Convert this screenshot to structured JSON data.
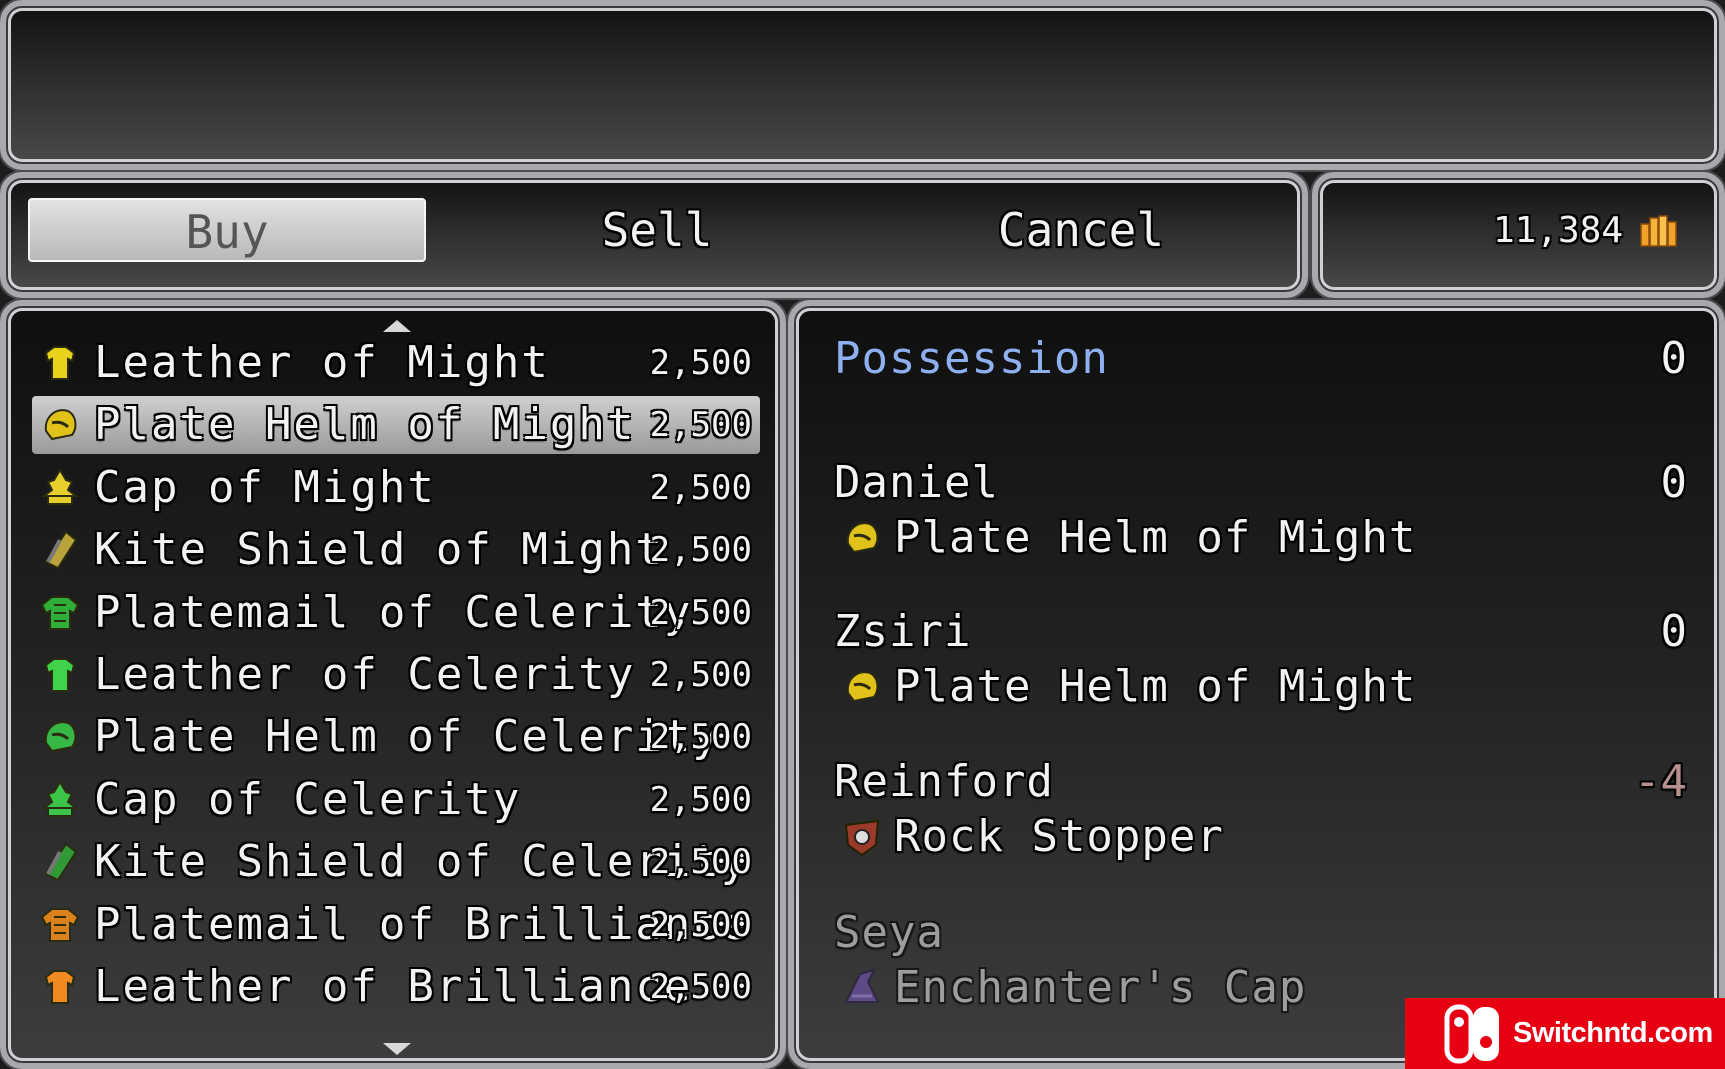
{
  "commands": [
    {
      "label": "Buy",
      "selected": true
    },
    {
      "label": "Sell",
      "selected": false
    },
    {
      "label": "Cancel",
      "selected": false
    }
  ],
  "gold": {
    "value": "11,384",
    "icon": "gold-coins-icon"
  },
  "items": [
    {
      "name": "Leather of Might",
      "price": "2,500",
      "icon": "leather-armor-icon",
      "color": "#e8d21c",
      "selected": false
    },
    {
      "name": "Plate Helm of Might",
      "price": "2,500",
      "icon": "plate-helm-icon",
      "color": "#e0c21a",
      "selected": true
    },
    {
      "name": "Cap of Might",
      "price": "2,500",
      "icon": "cap-icon",
      "color": "#e6cf2a",
      "selected": false
    },
    {
      "name": "Kite Shield of Might",
      "price": "2,500",
      "icon": "kite-shield-icon",
      "color": "#b8a43a",
      "selected": false
    },
    {
      "name": "Platemail of Celerity",
      "price": "2,500",
      "icon": "platemail-icon",
      "color": "#2fae3a",
      "selected": false
    },
    {
      "name": "Leather of Celerity",
      "price": "2,500",
      "icon": "leather-armor-icon",
      "color": "#3fd24a",
      "selected": false
    },
    {
      "name": "Plate Helm of Celerity",
      "price": "2,500",
      "icon": "plate-helm-icon",
      "color": "#36b846",
      "selected": false
    },
    {
      "name": "Cap of Celerity",
      "price": "2,500",
      "icon": "cap-icon",
      "color": "#3bc447",
      "selected": false
    },
    {
      "name": "Kite Shield of Celerity",
      "price": "2,500",
      "icon": "kite-shield-icon",
      "color": "#2f9a36",
      "selected": false
    },
    {
      "name": "Platemail of Brilliance",
      "price": "2,500",
      "icon": "platemail-icon",
      "color": "#d9821e",
      "selected": false
    },
    {
      "name": "Leather of Brilliance",
      "price": "2,500",
      "icon": "leather-armor-icon",
      "color": "#ef8a20",
      "selected": false
    }
  ],
  "status": {
    "possession_label": "Possession",
    "possession_value": "0",
    "possession_color": "#8fb0f0",
    "members": [
      {
        "name": "Daniel",
        "value": "0",
        "equip": "Plate Helm of Might",
        "equip_icon": "plate-helm-icon",
        "equip_color": "#e0c21a",
        "value_color": "#f2f2f2",
        "dim": false
      },
      {
        "name": "Zsiri",
        "value": "0",
        "equip": "Plate Helm of Might",
        "equip_icon": "plate-helm-icon",
        "equip_color": "#e0c21a",
        "value_color": "#f2f2f2",
        "dim": false
      },
      {
        "name": "Reinford",
        "value": "-4",
        "equip": "Rock Stopper",
        "equip_icon": "rock-shield-icon",
        "equip_color": "#9a3a2a",
        "value_color": "#b89090",
        "dim": false
      },
      {
        "name": "Seya",
        "value": "",
        "equip": "Enchanter's Cap",
        "equip_icon": "enchanter-cap-icon",
        "equip_color": "#7a5ac8",
        "value_color": "#f2f2f2",
        "dim": true
      }
    ]
  },
  "watermark": {
    "text": "Switchntd.com",
    "icon": "switch-logo-icon",
    "color": "#e60012"
  }
}
